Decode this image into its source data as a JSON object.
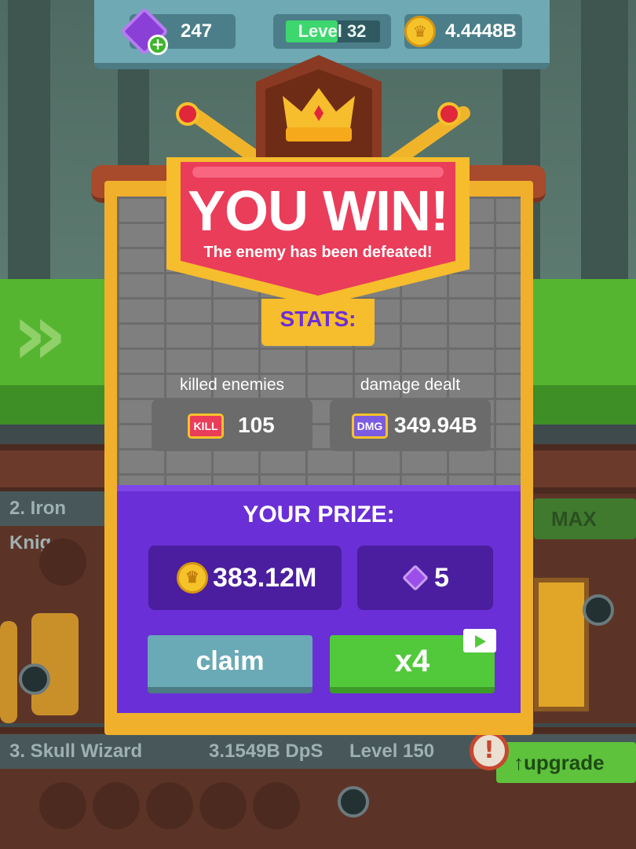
{
  "topbar": {
    "gems": "247",
    "level_label": "Level 32",
    "level_progress": 0.55,
    "coins": "4.4448B"
  },
  "dialog": {
    "title": "YOU WIN!",
    "subtitle": "The enemy has been defeated!",
    "stats_label": "STATS:",
    "stats": [
      {
        "caption": "killed enemies",
        "badge": "KILL",
        "value": "105"
      },
      {
        "caption": "damage dealt",
        "badge": "DMG",
        "value": "349.94B"
      }
    ],
    "prize_title": "YOUR PRIZE:",
    "prize_coins": "383.12M",
    "prize_gems": "5",
    "claim_label": "claim",
    "multiplier_label": "x4"
  },
  "background": {
    "lane1_label": "2. Iron Knig",
    "max_label": "MAX",
    "lane2_name": "3. Skull Wizard",
    "lane2_dps": "3.1549B DpS",
    "lane2_level": "Level 150",
    "upgrade_label": "↑upgrade"
  },
  "colors": {
    "accent_purple": "#6a2fd6",
    "win_red": "#ea3d5a",
    "gold": "#f6bd2c",
    "green_button": "#52c93a",
    "claim_button": "#6aa9b6"
  },
  "icons": [
    "gem-icon",
    "plus-icon",
    "coin-icon",
    "crown-icon",
    "kill-badge",
    "dmg-badge",
    "video-icon",
    "warning-icon"
  ]
}
